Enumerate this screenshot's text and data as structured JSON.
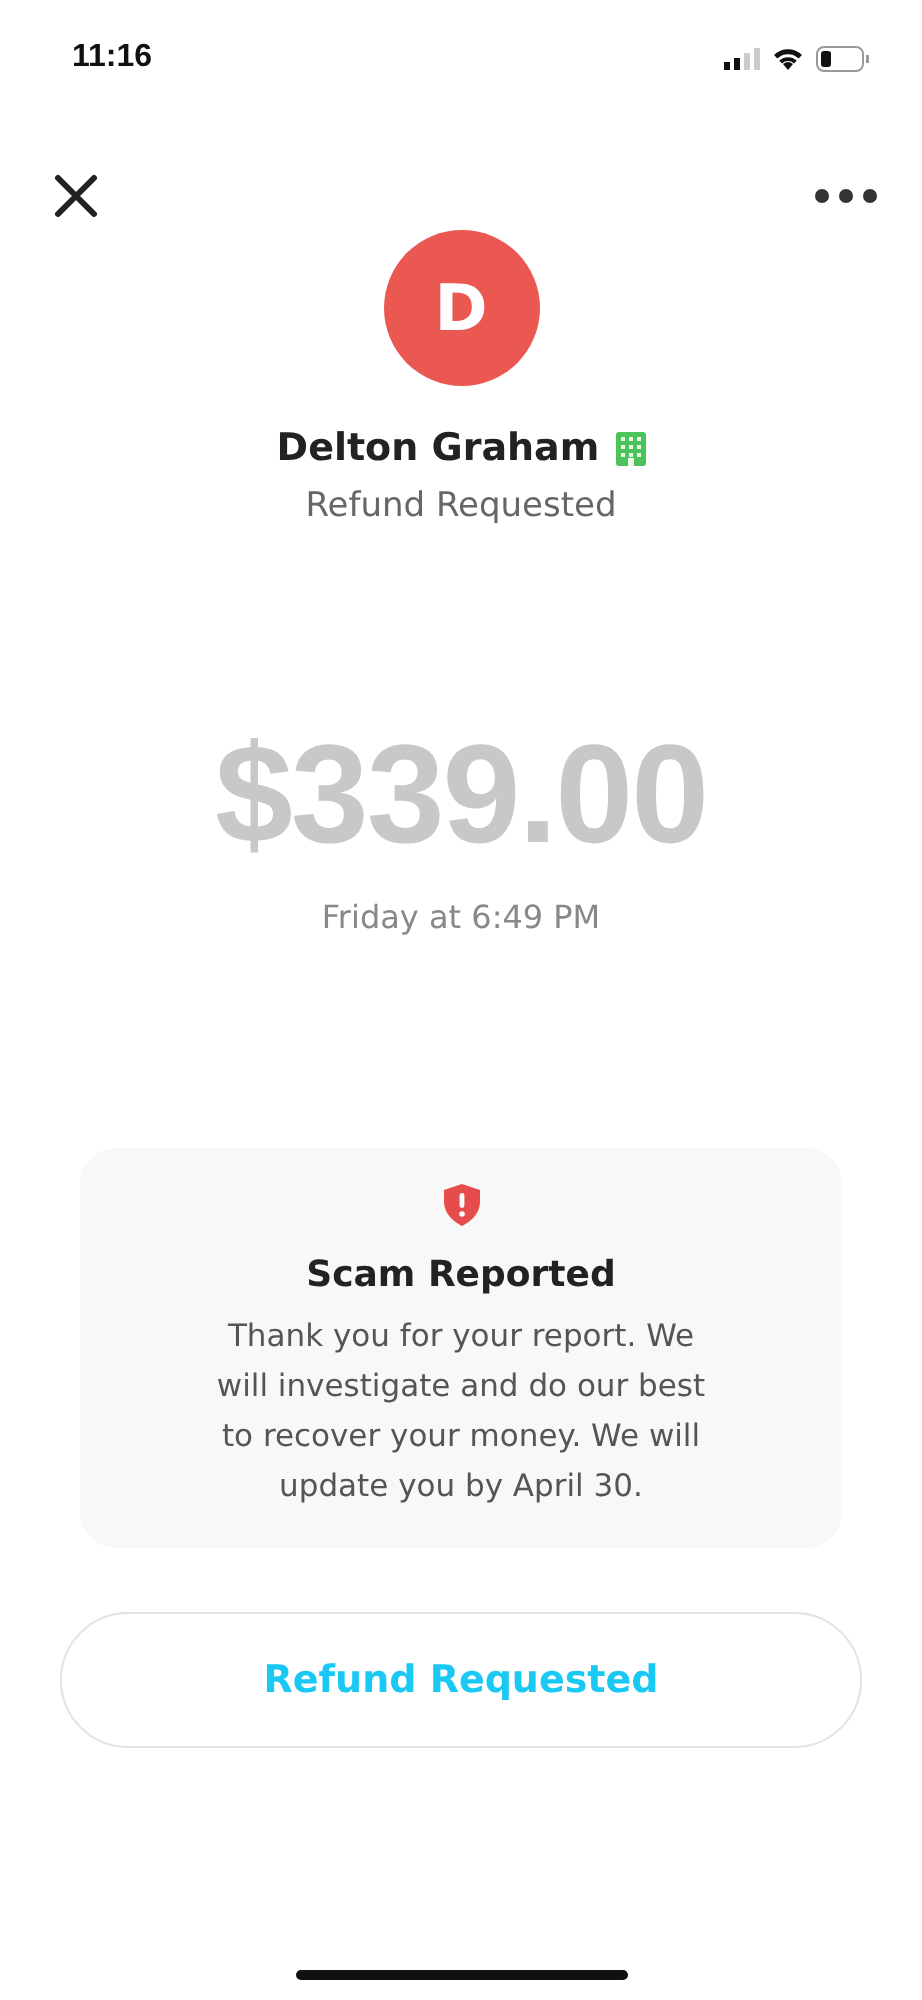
{
  "status_bar": {
    "time": "11:16"
  },
  "header": {
    "avatar_initial": "D",
    "name": "Delton Graham",
    "business": true,
    "subtitle": "Refund Requested"
  },
  "amount": "$339.00",
  "date": "Friday at 6:49 PM",
  "notice": {
    "title": "Scam Reported",
    "message": "Thank you for your report. We will investigate and do our best to recover your money. We will update you by April 30."
  },
  "button": "Refund Requested"
}
